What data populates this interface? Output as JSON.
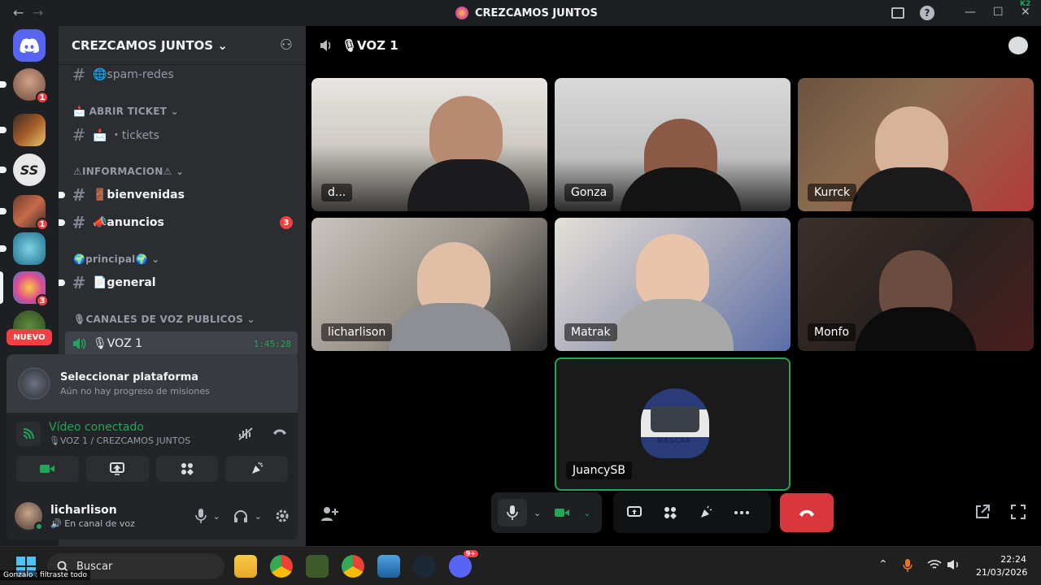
{
  "window": {
    "title": "CREZCAMOS JUNTOS",
    "back_glyph": "←",
    "forward_glyph": "→",
    "ctl_help": "?",
    "ctl_min": "—",
    "ctl_max": "☐",
    "ctl_close": "✕",
    "corner_badge": "K2"
  },
  "rail": {
    "badges": [
      "1",
      "1",
      "3"
    ],
    "nuevo_label": "NUEVO"
  },
  "sidebar": {
    "server_name": "CREZCAMOS JUNTOS",
    "chevron": "⌄",
    "add_member_glyph": "⚇",
    "channels": {
      "spam": "🌐spam-redes",
      "cat_ticket": "📩 ABRIR TICKET ⌄",
      "tickets": "📩 ・tickets",
      "cat_info": "⚠INFORMACION⚠ ⌄",
      "bienvenidas": "🚪bienvenidas",
      "anuncios": "📣anuncios",
      "anuncios_mentions": "3",
      "cat_principal": "🌍principal🌍 ⌄",
      "general": "📄general",
      "cat_voice": "🎙CANALES DE VOZ PUBLICOS ⌄",
      "voice_channel": "🎙VOZ 1",
      "voice_time": "1:45:28"
    },
    "hash": "#"
  },
  "quest": {
    "title": "Seleccionar plataforma",
    "subtitle": "Aún no hay progreso de misiones"
  },
  "rtc": {
    "status": "Vídeo conectado",
    "location": "🎙VOZ 1 / CREZCAMOS JUNTOS"
  },
  "user": {
    "name": "licharlison",
    "status": "🔊 En canal de voz"
  },
  "voice": {
    "channel": "🎙VOZ 1",
    "participants": [
      "d...",
      "Gonza",
      "Kurrck",
      "licharlison",
      "Matrak",
      "Monfo",
      "JuancySB"
    ],
    "helmet_text": "NASCAR"
  },
  "taskbar": {
    "search_placeholder": "Buscar",
    "time": "22:24",
    "date": "21/03/2026",
    "discord_badge": "9+",
    "overlay_text": "Gonzalo : filtraste todo"
  },
  "colors": {
    "accent_green": "#23a55a",
    "danger_red": "#da373c",
    "blurple": "#5865f2"
  }
}
